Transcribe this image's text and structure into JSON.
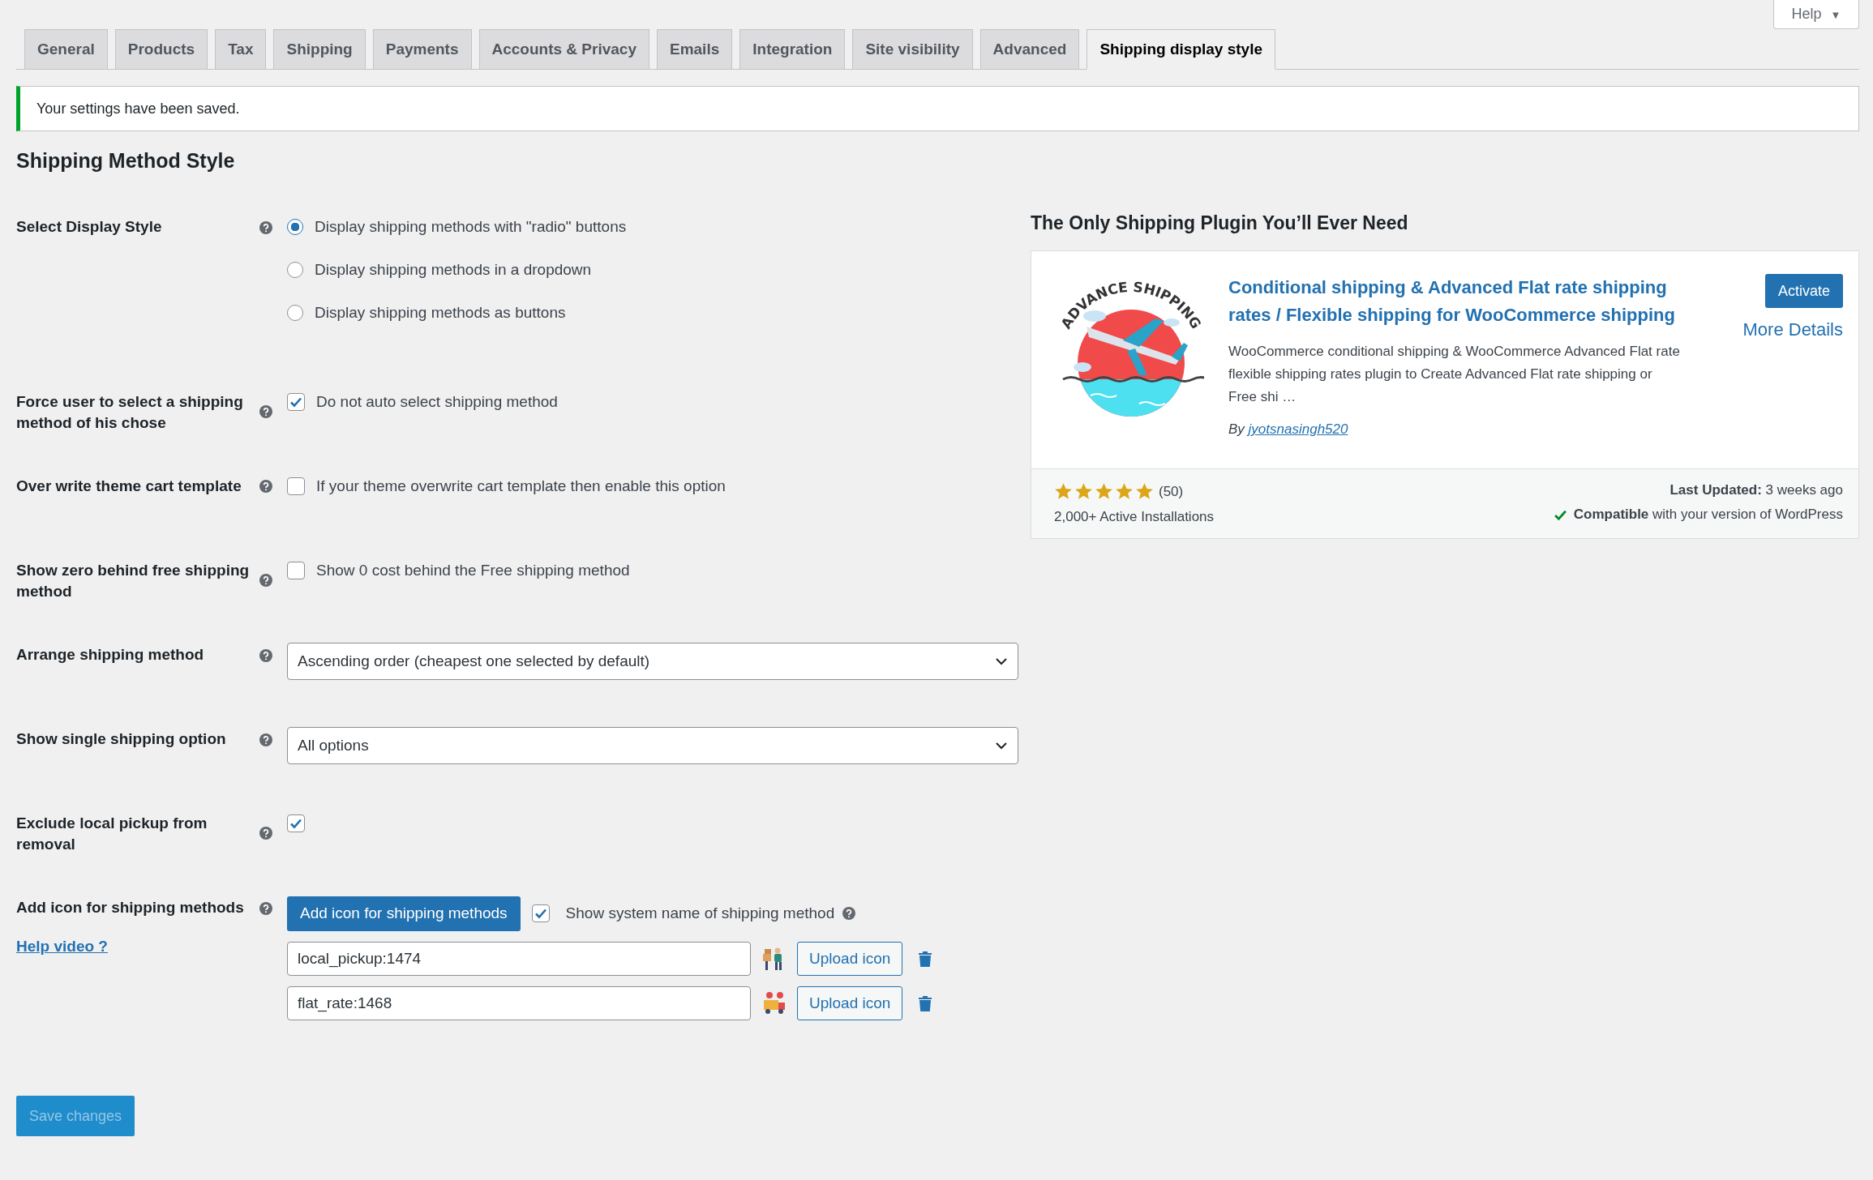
{
  "help_menu": {
    "label": "Help",
    "caret": "▼"
  },
  "tabs": [
    {
      "label": "General",
      "selected": false
    },
    {
      "label": "Products",
      "selected": false
    },
    {
      "label": "Tax",
      "selected": false
    },
    {
      "label": "Shipping",
      "selected": false
    },
    {
      "label": "Payments",
      "selected": false
    },
    {
      "label": "Accounts & Privacy",
      "selected": false
    },
    {
      "label": "Emails",
      "selected": false
    },
    {
      "label": "Integration",
      "selected": false
    },
    {
      "label": "Site visibility",
      "selected": false
    },
    {
      "label": "Advanced",
      "selected": false
    },
    {
      "label": "Shipping display style",
      "selected": true
    }
  ],
  "notice": "Your settings have been saved.",
  "section_title": "Shipping Method Style",
  "settings": [
    {
      "kind": "radio_group",
      "label": "Select Display Style",
      "options": [
        {
          "label": "Display shipping methods with \"radio\" buttons",
          "selected": true
        },
        {
          "label": "Display shipping methods in a dropdown",
          "selected": false
        },
        {
          "label": "Display shipping methods as buttons",
          "selected": false
        }
      ]
    },
    {
      "kind": "checkbox",
      "label": "Force user to select a shipping method of his chose",
      "checked": true,
      "text": "Do not auto select shipping method"
    },
    {
      "kind": "checkbox",
      "label": "Over write theme cart template",
      "checked": false,
      "text": "If your theme overwrite cart template then enable this option"
    },
    {
      "kind": "checkbox",
      "label": "Show zero behind free shipping method",
      "checked": false,
      "text": "Show 0 cost behind the Free shipping method"
    },
    {
      "kind": "select",
      "label": "Arrange shipping method",
      "value": "Ascending order (cheapest one selected by default)"
    },
    {
      "kind": "select",
      "label": "Show single shipping option",
      "value": "All options"
    },
    {
      "kind": "checkbox",
      "label": "Exclude local pickup from removal",
      "checked": true
    },
    {
      "kind": "icon_methods",
      "label": "Add icon for shipping methods",
      "link": "Help video ?",
      "button": "Add icon for shipping methods",
      "show_system_name": {
        "label": "Show system name of shipping method",
        "checked": true
      },
      "methods": [
        {
          "value": "local_pickup:1474",
          "upload": "Upload icon"
        },
        {
          "value": "flat_rate:1468",
          "upload": "Upload icon"
        }
      ]
    }
  ],
  "save_button": {
    "label": "Save changes",
    "disabled": true
  },
  "promo": {
    "heading": "The Only Shipping Plugin You’ll Ever Need",
    "logo_text": "ADVANCE SHIPPING",
    "title": "Conditional shipping & Advanced Flat rate shipping rates / Flexible shipping for WooCommerce shipping",
    "activate": "Activate",
    "more_details": "More Details",
    "description": "WooCommerce conditional shipping & WooCommerce Advanced Flat rate flexible shipping rates plugin to Create Advanced Flat rate shipping or Free shi …",
    "author_prefix": "By",
    "author": "jyotsnasingh520",
    "stars": 5,
    "rating_count": "(50)",
    "installs": "2,000+ Active Installations",
    "last_updated": "**Last Updated:** 3 weeks ago",
    "compatible": "**Compatible** with your version of WordPress"
  }
}
